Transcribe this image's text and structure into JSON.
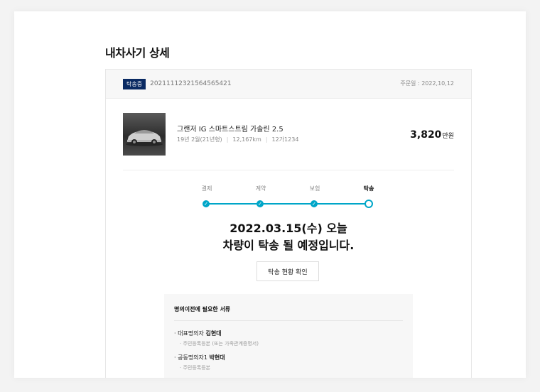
{
  "page": {
    "title": "내차사기 상세"
  },
  "order": {
    "status": "탁송중",
    "number": "20211112321564565421",
    "date": "주문일 : 2022,10,12"
  },
  "car": {
    "name": "그랜저 IG 스마트스트림 가솔린 2.5",
    "year": "19년 2월(21년형)",
    "mileage": "12,167km",
    "plate": "12가1234",
    "price": "3,820",
    "price_unit": "만원"
  },
  "steps": [
    {
      "label": "결제",
      "state": "done"
    },
    {
      "label": "계약",
      "state": "done"
    },
    {
      "label": "보험",
      "state": "done"
    },
    {
      "label": "탁송",
      "state": "current"
    }
  ],
  "delivery": {
    "date_line": "2022.03.15(수) 오늘",
    "message": "차량이 탁송 될 예정입니다.",
    "button": "탁송 현황 확인"
  },
  "documents": {
    "title": "명의이전에 필요한 서류",
    "entries": [
      {
        "role": "대표명의자",
        "name": "김현대",
        "doc": "주민등록등본 (또는 가족관계증명서)"
      },
      {
        "role": "공동명의자1",
        "name": "박현대",
        "doc": "주민등록등본"
      }
    ]
  },
  "colors": {
    "accent": "#00a6c8",
    "badge": "#0a2a63"
  }
}
